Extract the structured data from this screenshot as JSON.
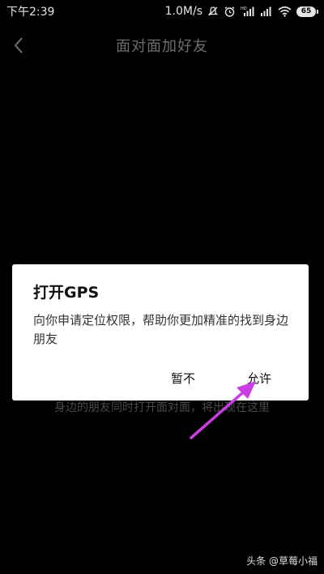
{
  "status_bar": {
    "time": "下午2:39",
    "network_speed": "1.0M/s",
    "battery": "65",
    "icons": [
      "mute-icon",
      "alarm-icon",
      "hd-signal-icon",
      "signal-icon",
      "wifi-icon",
      "battery-icon"
    ]
  },
  "header": {
    "title": "面对面加好友",
    "back_icon": "chevron-left-icon"
  },
  "main": {
    "hint": "身边的朋友同时打开面对面，将出现在这里"
  },
  "dialog": {
    "title": "打开GPS",
    "message": "向你申请定位权限，帮助你更加精准的找到身边朋友",
    "deny_label": "暂不",
    "allow_label": "允许"
  },
  "annotation": {
    "arrow_color": "#c93ee0"
  },
  "watermark": "头条 @草莓小福",
  "colors": {
    "background": "#000000",
    "dialog_bg": "#ffffff",
    "title_gray": "#6e6e6e"
  }
}
